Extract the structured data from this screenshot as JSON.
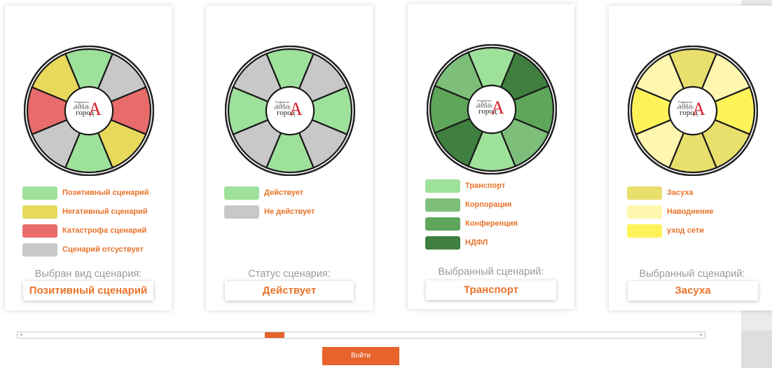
{
  "logo": {
    "small_text": "Росблаготс",
    "main_text": "город",
    "letter": "А"
  },
  "cards": [
    {
      "id": "scenario-type",
      "segment_colors": [
        "#9ee19b",
        "#c8c8c8",
        "#e86c6c",
        "#e8d95c",
        "#9ee19b",
        "#c8c8c8",
        "#e86c6c",
        "#e8d95c"
      ],
      "legend": [
        {
          "label": "Позитивный сценарий",
          "color": "#9ee19b"
        },
        {
          "label": "Негативный сценарий",
          "color": "#e8d95c"
        },
        {
          "label": "Катастрофа сценарий",
          "color": "#e86c6c"
        },
        {
          "label": "Сценарий отсуствует",
          "color": "#c8c8c8"
        }
      ],
      "caption": "Выбран вид сценария:",
      "value": "Позитивный сценарий"
    },
    {
      "id": "scenario-status",
      "segment_colors": [
        "#9ee19b",
        "#c8c8c8",
        "#9ee19b",
        "#c8c8c8",
        "#9ee19b",
        "#c8c8c8",
        "#9ee19b",
        "#c8c8c8"
      ],
      "legend": [
        {
          "label": "Действует",
          "color": "#9ee19b"
        },
        {
          "label": "Не действует",
          "color": "#c8c8c8"
        }
      ],
      "caption": "Статус сценария:",
      "value": "Действует"
    },
    {
      "id": "selected-scenario-green",
      "segment_colors": [
        "#9ee19b",
        "#3f7f3f",
        "#5ea65a",
        "#7dbf7a",
        "#9ee19b",
        "#3f7f3f",
        "#5ea65a",
        "#7dbf7a"
      ],
      "legend": [
        {
          "label": "Транспорт",
          "color": "#9ee19b"
        },
        {
          "label": "Корпорация",
          "color": "#7dbf7a"
        },
        {
          "label": "Конференция",
          "color": "#5ea65a"
        },
        {
          "label": "НДФЛ",
          "color": "#3f7f3f"
        }
      ],
      "caption": "Выбранный сценарий:",
      "value": "Транспорт"
    },
    {
      "id": "selected-scenario-yellow",
      "segment_colors": [
        "#e8df6c",
        "#fff6b0",
        "#fff35a",
        "#e8df6c",
        "#e8df6c",
        "#fff6b0",
        "#fff35a",
        "#fff6b0"
      ],
      "legend": [
        {
          "label": "Засуха",
          "color": "#e8df6c"
        },
        {
          "label": "Наводнение",
          "color": "#fff6b0"
        },
        {
          "label": "уход сети",
          "color": "#fff35a"
        }
      ],
      "caption": "Выбранный сценарий:",
      "value": "Засуха"
    }
  ],
  "scrollbar": {
    "position": 0.37
  },
  "enter_button": {
    "label": "Войти"
  }
}
